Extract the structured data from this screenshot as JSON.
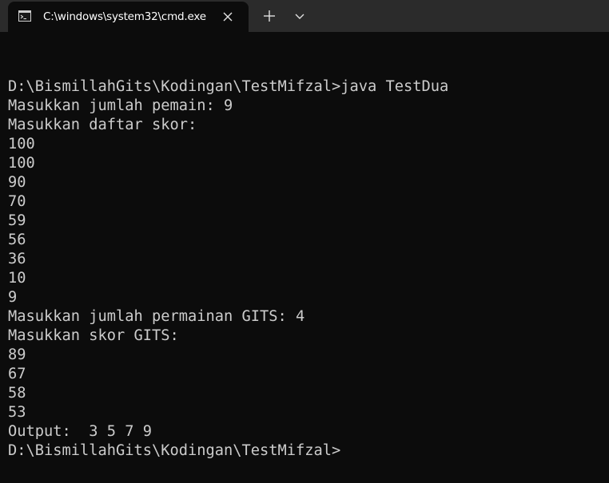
{
  "titlebar": {
    "tab_title": "C:\\windows\\system32\\cmd.exe",
    "icons": {
      "tab": "terminal-icon",
      "close": "close-icon",
      "new_tab": "plus-icon",
      "dropdown": "chevron-down-icon"
    }
  },
  "console": {
    "lines": [
      "",
      "D:\\BismillahGits\\Kodingan\\TestMifzal>java TestDua",
      "Masukkan jumlah pemain: 9",
      "Masukkan daftar skor:",
      "100",
      "100",
      "90",
      "70",
      "59",
      "56",
      "36",
      "10",
      "9",
      "Masukkan jumlah permainan GITS: 4",
      "Masukkan skor GITS:",
      "89",
      "67",
      "58",
      "53",
      "Output:  3 5 7 9",
      "D:\\BismillahGits\\Kodingan\\TestMifzal>"
    ]
  },
  "colors": {
    "background": "#0c0c0c",
    "titlebar": "#2b2b2b",
    "text": "#cccccc"
  }
}
